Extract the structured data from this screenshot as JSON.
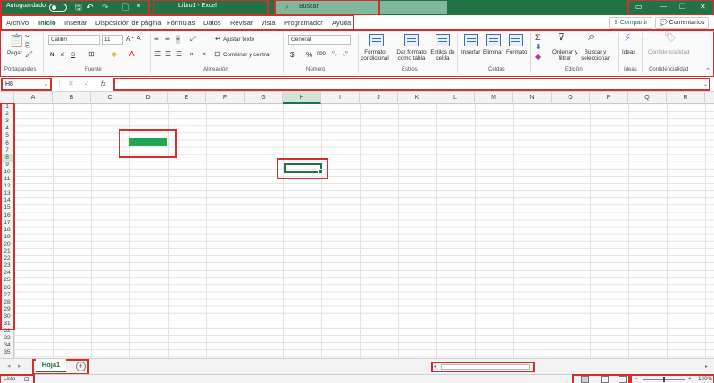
{
  "titlebar": {
    "autosave_label": "Autoguardado",
    "doc_title": "Libro1  -  Excel",
    "search_placeholder": "Buscar",
    "minimize": "—",
    "restore": "❐",
    "close": "✕"
  },
  "tabs": [
    "Archivo",
    "Inicio",
    "Insertar",
    "Disposición de página",
    "Fórmulas",
    "Datos",
    "Revisar",
    "Vista",
    "Programador",
    "Ayuda"
  ],
  "active_tab": "Inicio",
  "share_label": "Compartir",
  "comments_label": "Comentarios",
  "ribbon": {
    "clipboard": {
      "paste": "Pegar",
      "group": "Portapapeles"
    },
    "font": {
      "name": "Calibri",
      "size": "11",
      "bold": "N",
      "italic": "K",
      "underline": "S",
      "group": "Fuente"
    },
    "alignment": {
      "wrap": "Ajustar texto",
      "merge": "Combinar y centrar",
      "group": "Alineación"
    },
    "number": {
      "format": "General",
      "currency": "$",
      "percent": "%",
      "thousands": "000",
      "group": "Número"
    },
    "styles": {
      "conditional": "Formato condicional",
      "table": "Dar formato como tabla",
      "cell": "Estilos de celda",
      "group": "Estilos"
    },
    "cells": {
      "insert": "Insertar",
      "delete": "Eliminar",
      "format": "Formato",
      "group": "Celdas"
    },
    "editing": {
      "sort": "Ordenar y filtrar",
      "find": "Buscar y seleccionar",
      "group": "Edición"
    },
    "ideas": {
      "label": "Ideas",
      "group": "Ideas"
    },
    "sensitivity": {
      "label": "Confidencialidad",
      "group": "Confidencialidad"
    }
  },
  "formula_bar": {
    "name_box": "H8",
    "fx": "fx",
    "formula": ""
  },
  "columns": [
    "A",
    "B",
    "C",
    "D",
    "E",
    "F",
    "G",
    "H",
    "I",
    "J",
    "K",
    "L",
    "M",
    "N",
    "O",
    "P",
    "Q",
    "R"
  ],
  "selected_column": "H",
  "rows": [
    "1",
    "2",
    "3",
    "4",
    "5",
    "6",
    "7",
    "8",
    "9",
    "10",
    "11",
    "12",
    "13",
    "14",
    "15",
    "16",
    "17",
    "18",
    "19",
    "20",
    "21",
    "22",
    "23",
    "24",
    "25",
    "26",
    "27",
    "28",
    "29",
    "30",
    "31",
    "32",
    "33",
    "34",
    "35"
  ],
  "selected_row": "8",
  "sheet": {
    "tab": "Hoja1",
    "add": "+"
  },
  "status": {
    "ready": "Listo",
    "zoom": "100%"
  },
  "colors": {
    "excel_green": "#217346",
    "cell_fill": "#22a654"
  }
}
